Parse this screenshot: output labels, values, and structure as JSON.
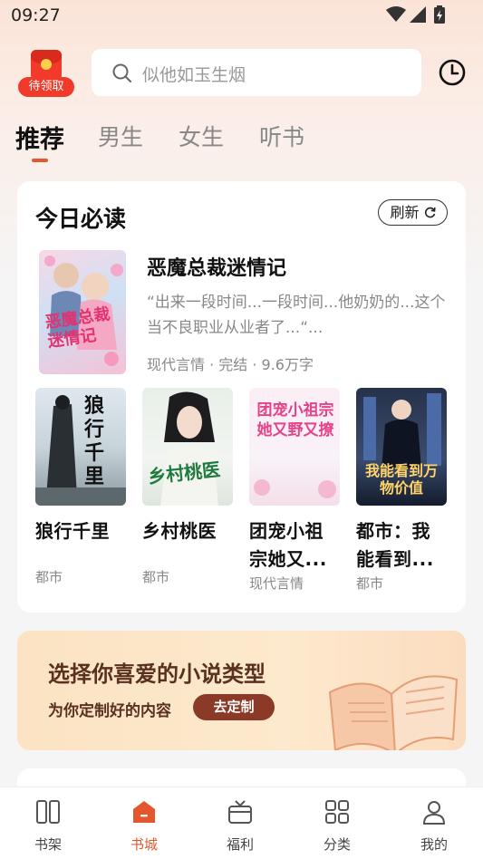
{
  "status_bar": {
    "time": "09:27"
  },
  "header": {
    "redpacket_label": "待领取",
    "search_placeholder": "似他如玉生烟"
  },
  "tabs": [
    {
      "label": "推荐",
      "active": true
    },
    {
      "label": "男生",
      "active": false
    },
    {
      "label": "女生",
      "active": false
    },
    {
      "label": "听书",
      "active": false
    }
  ],
  "daily": {
    "title": "今日必读",
    "refresh_label": "刷新",
    "featured": {
      "cover_text": "恶魔总裁迷情记",
      "name": "恶魔总裁迷情记",
      "description": "“出来一段时间...一段时间...他奶奶的...这个当不良职业从业者了...“...",
      "meta": "现代言情 · 完结 · 9.6万字"
    },
    "books": [
      {
        "cover_text": "狼行千里",
        "name": "狼行千里",
        "category": "都市"
      },
      {
        "cover_text": "乡村桃医",
        "name": "乡村桃医",
        "category": "都市"
      },
      {
        "cover_text": "团宠小祖宗她又野又撩",
        "name": "团宠小祖宗她又...",
        "category": "现代言情"
      },
      {
        "cover_text": "我能看到万物价值",
        "name": "都市：我能看到...",
        "category": "都市"
      }
    ]
  },
  "banner": {
    "heading": "选择你喜爱的小说类型",
    "subtitle": "为你定制好的内容",
    "button_label": "去定制"
  },
  "nav": [
    {
      "label": "书架",
      "icon": "bookshelf-icon",
      "active": false
    },
    {
      "label": "书城",
      "icon": "bookstore-icon",
      "active": true
    },
    {
      "label": "福利",
      "icon": "gift-icon",
      "active": false
    },
    {
      "label": "分类",
      "icon": "category-grid-icon",
      "active": false
    },
    {
      "label": "我的",
      "icon": "profile-icon",
      "active": false
    }
  ],
  "colors": {
    "accent": "#e4572e",
    "redpacket": "#f23a2a",
    "banner_button": "#8a3a26"
  }
}
